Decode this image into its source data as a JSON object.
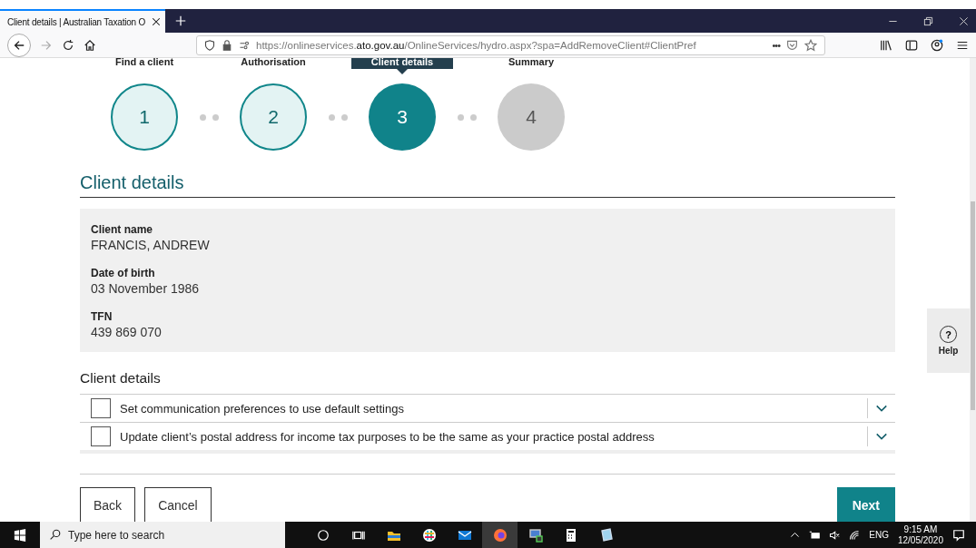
{
  "browser": {
    "tab_title": "Client details | Australian Taxation O",
    "url_prefix": "https://onlineservices.",
    "url_domain": "ato.gov.au",
    "url_suffix": "/OnlineServices/hydro.aspx?spa=AddRemoveClient#ClientPref",
    "page_actions": "•••"
  },
  "steps": [
    {
      "label": "Find a client",
      "number": "1",
      "completed": true,
      "selected": false
    },
    {
      "label": "Authorisation",
      "number": "2",
      "completed": true,
      "selected": false
    },
    {
      "label": "Client details",
      "number": "3",
      "completed": false,
      "selected": true
    },
    {
      "label": "Summary",
      "number": "4",
      "completed": false,
      "selected": false
    }
  ],
  "page_title": "Client details",
  "client_info": [
    {
      "label": "Client name",
      "value": "FRANCIS, ANDREW"
    },
    {
      "label": "Date of birth",
      "value": "03 November 1986"
    },
    {
      "label": "TFN",
      "value": "439 869 070"
    }
  ],
  "options_title": "Client details",
  "options": [
    {
      "label": "Set communication preferences to use default settings",
      "checked": false,
      "expanded": false
    },
    {
      "label": "Update client’s postal address for income tax purposes to be the same as your practice postal address",
      "checked": false,
      "expanded": false
    }
  ],
  "buttons": {
    "back": "Back",
    "cancel": "Cancel",
    "next": "Next"
  },
  "help": {
    "icon": "?",
    "label": "Help"
  },
  "taskbar": {
    "search_placeholder": "Type here to search",
    "language": "ENG",
    "time": "9:15 AM",
    "date": "12/05/2020"
  }
}
